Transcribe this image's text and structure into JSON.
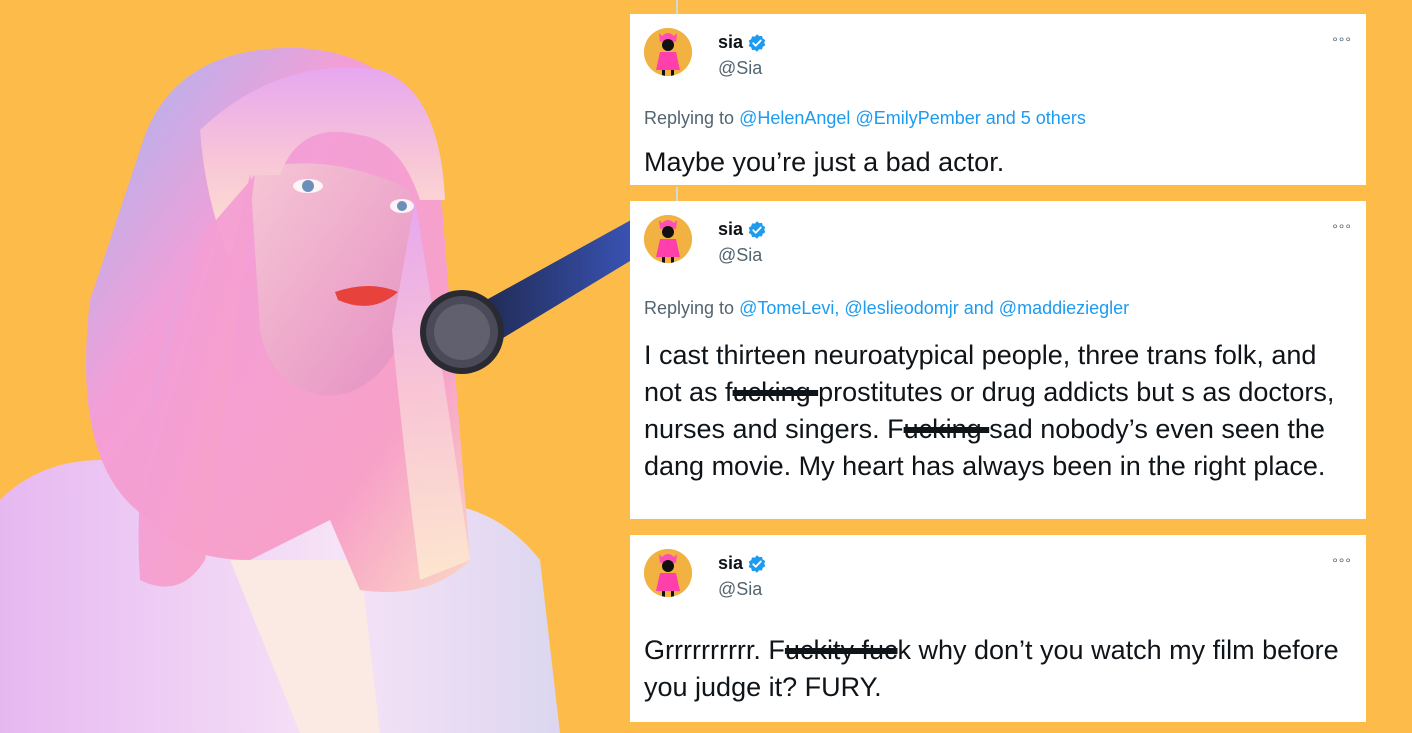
{
  "colors": {
    "background": "#fdbc4a",
    "card": "#ffffff",
    "text_primary": "#0f1419",
    "text_secondary": "#536471",
    "mention": "#1d9bf0",
    "verified": "#1d9bf0"
  },
  "portrait": {
    "icon": "singer-with-microphone-photo"
  },
  "tweets": [
    {
      "display_name": "sia",
      "handle": "@Sia",
      "verified": true,
      "more_icon": "more-icon",
      "replying_prefix": "Replying to",
      "mentions": [
        "@HelenAngel",
        "@EmilyPember"
      ],
      "others": "and 5 others",
      "text": "Maybe you’re just a bad actor."
    },
    {
      "display_name": "sia",
      "handle": "@Sia",
      "verified": true,
      "more_icon": "more-icon",
      "replying_prefix": "Replying to",
      "mentions": [
        "@TomeLevi,",
        "@leslieodomjr"
      ],
      "joiner": "and",
      "last_mention": "@maddieziegler",
      "text_parts": [
        "I cast thirteen neuroatypical people, three trans folk, and not as f",
        "ucking ",
        "prostitutes or drug addicts but s as doctors, nurses and singers. F",
        "ucking ",
        "sad nobody’s even seen the dang movie. My heart has always been in the right place."
      ]
    },
    {
      "display_name": "sia",
      "handle": "@Sia",
      "verified": true,
      "more_icon": "more-icon",
      "text_parts": [
        "Grrrrrrrrrr. F",
        "uckity fuc",
        "k why don’t you watch my film before you judge it? FURY."
      ]
    }
  ]
}
